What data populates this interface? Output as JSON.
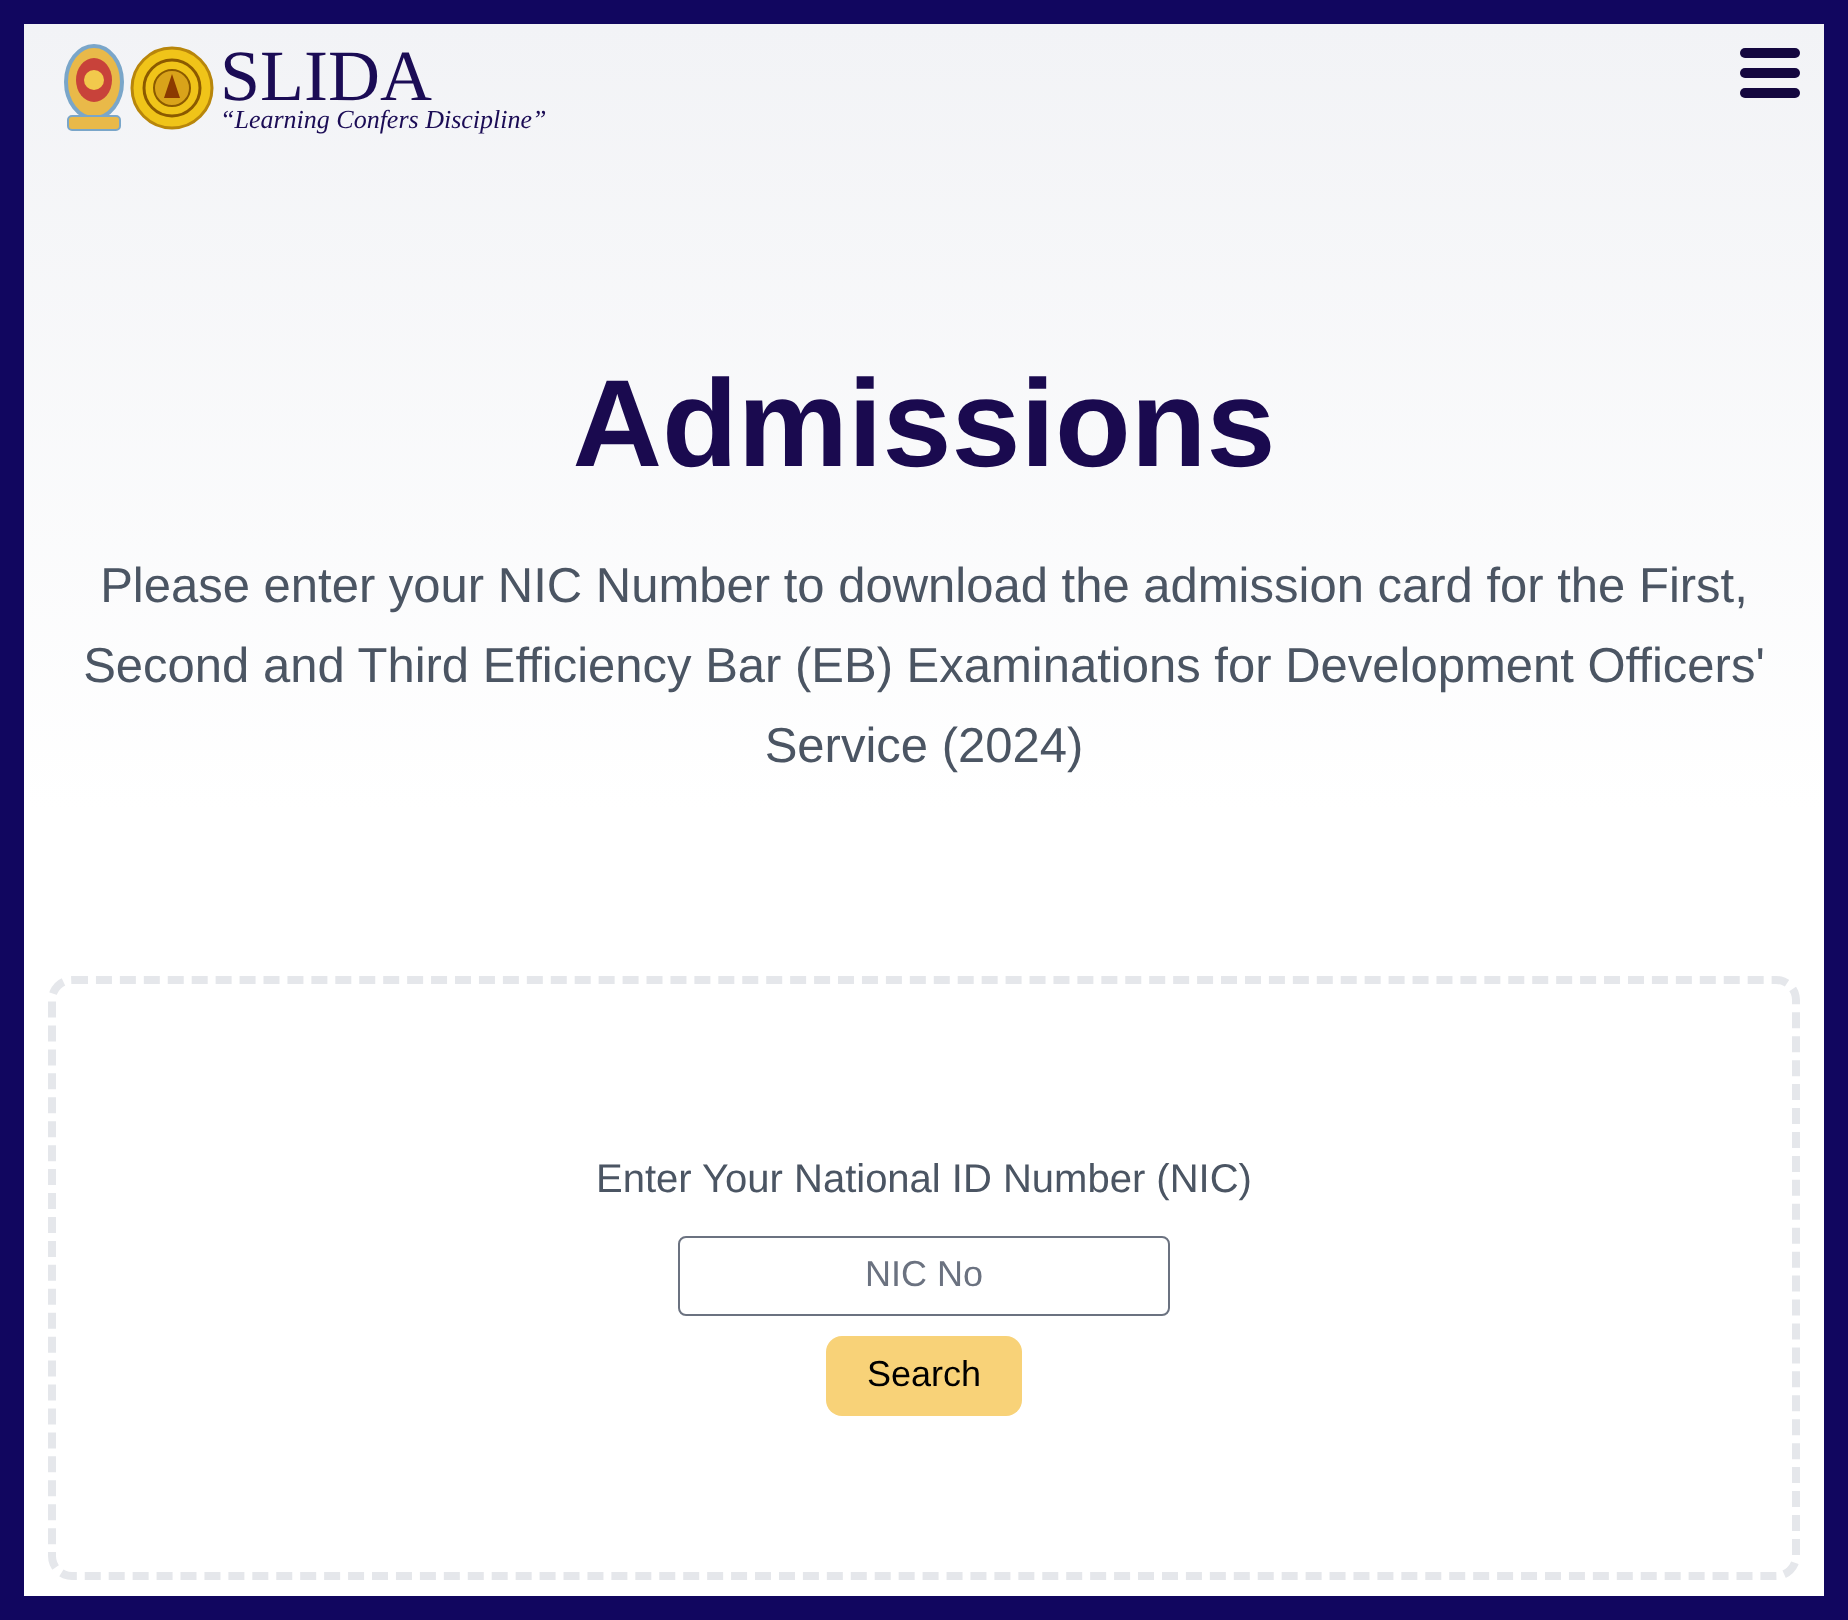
{
  "header": {
    "logo": {
      "name": "SLIDA",
      "tagline": "“Learning Confers Discipline”"
    }
  },
  "intro": {
    "title": "Admissions",
    "description": "Please enter your NIC Number to download the admission card for the First, Second and Third Efficiency Bar (EB) Examinations for Development Officers' Service (2024)"
  },
  "search_form": {
    "label": "Enter Your National ID Number (NIC)",
    "nic_field": {
      "placeholder": "NIC No"
    },
    "button": "Search"
  }
}
